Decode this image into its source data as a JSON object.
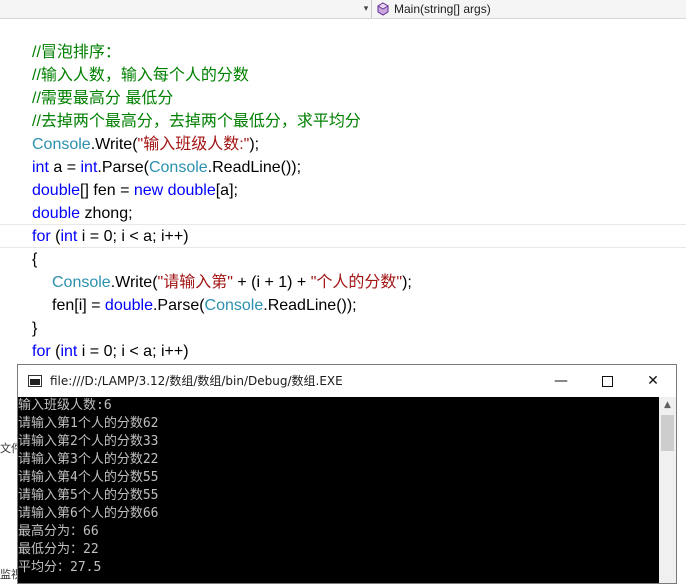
{
  "navbar": {
    "dropdown_arrow": "▾",
    "method": "Main(string[] args)"
  },
  "code": {
    "comment1": "//冒泡排序：",
    "comment2": "//输入人数，输入每个人的分数",
    "comment3": "//需要最高分 最低分",
    "comment4": "//去掉两个最高分，去掉两个最低分，求平均分",
    "l5_type": "Console",
    "l5_a": ".Write(",
    "l5_str": "\"输入班级人数:\"",
    "l5_b": ");",
    "l6_kw1": "int",
    "l6_a": " a = ",
    "l6_kw2": "int",
    "l6_b": ".Parse(",
    "l6_type": "Console",
    "l6_c": ".ReadLine());",
    "l7_kw1": "double",
    "l7_a": "[] fen = ",
    "l7_kw2": "new",
    "l7_sp": " ",
    "l7_kw3": "double",
    "l7_b": "[a];",
    "l8_kw": "double",
    "l8_a": " zhong;",
    "l9_kw1": "for",
    "l9_a": " (",
    "l9_kw2": "int",
    "l9_b": " i = 0; i < a; i++)",
    "l10": "{",
    "l11_type": "Console",
    "l11_a": ".Write(",
    "l11_str1": "\"请输入第\"",
    "l11_b": " + (i + 1) + ",
    "l11_str2": "\"个人的分数\"",
    "l11_c": ");",
    "l12_a": "fen[i] = ",
    "l12_kw": "double",
    "l12_b": ".Parse(",
    "l12_type": "Console",
    "l12_c": ".ReadLine());",
    "l13": "}",
    "l14_kw1": "for",
    "l14_a": " (",
    "l14_kw2": "int",
    "l14_b": " i = 0; i < a; i++)"
  },
  "side": {
    "frag1": "文件",
    "frag2": "监视"
  },
  "console": {
    "title": "file:///D:/LAMP/3.12/数组/数组/bin/Debug/数组.EXE",
    "min": "—",
    "close": "✕",
    "lines": [
      "输入班级人数:6",
      "请输入第1个人的分数62",
      "请输入第2个人的分数33",
      "请输入第3个人的分数22",
      "请输入第4个人的分数55",
      "请输入第5个人的分数55",
      "请输入第6个人的分数66",
      "最高分为：66",
      "最低分为：22",
      "平均分：27.5"
    ],
    "scroll_up": "▲"
  },
  "colors": {
    "comment": "#008000",
    "keyword": "#0000ff",
    "type": "#2b91af",
    "string": "#a31515"
  }
}
